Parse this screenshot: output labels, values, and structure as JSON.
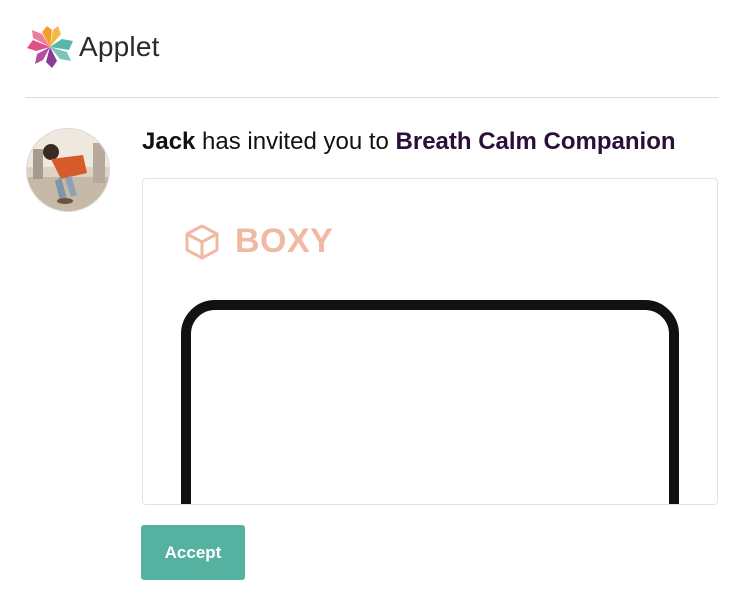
{
  "header": {
    "brand_name": "Applet",
    "logo_icon": "applet-logo-icon",
    "logo_colors": [
      "#f0a02a",
      "#59b6a6",
      "#8a3c94",
      "#e14f87"
    ]
  },
  "invite": {
    "inviter": "Jack",
    "message": " has invited you to ",
    "app_name": "Breath Calm Companion",
    "app_name_color": "#2b0f3a"
  },
  "avatar": {
    "icon": "user-avatar"
  },
  "preview": {
    "brand_text": "BOXY",
    "brand_icon": "cube-icon",
    "brand_color": "#f1b9a4"
  },
  "actions": {
    "accept_label": "Accept",
    "accept_color": "#55b2a0"
  }
}
